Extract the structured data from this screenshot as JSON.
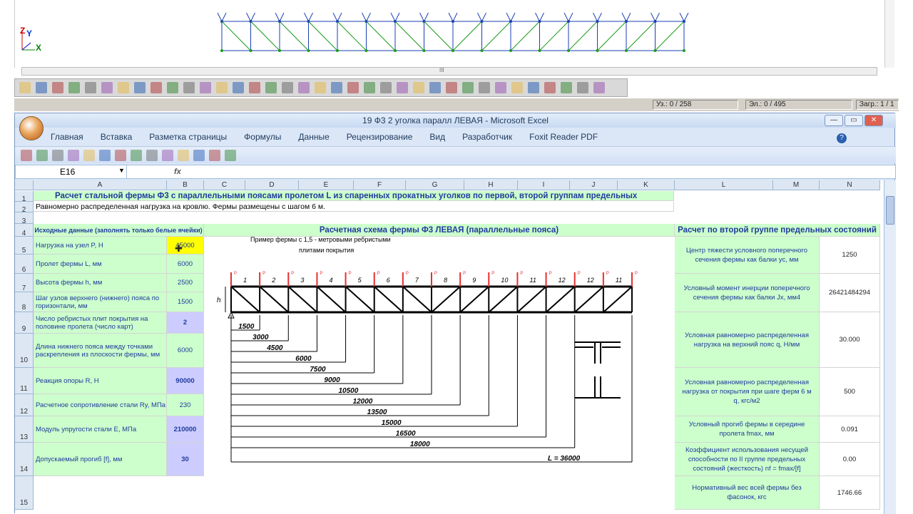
{
  "cad": {
    "axis_z": "Z",
    "axis_y": "Y",
    "axis_x": "X",
    "scroll_grip": "III",
    "status": [
      "Уз.: 0 / 258",
      "Эл.: 0 / 495",
      "Загр.: 1 / 1"
    ]
  },
  "excel": {
    "title": "19 Ф3 2 уголка паралл ЛЕВАЯ - Microsoft Excel",
    "tabs": [
      "Главная",
      "Вставка",
      "Разметка страницы",
      "Формулы",
      "Данные",
      "Рецензирование",
      "Вид",
      "Разработчик",
      "Foxit Reader PDF"
    ],
    "name_box": "E16",
    "fx": "fx",
    "columns": [
      "A",
      "B",
      "C",
      "D",
      "E",
      "F",
      "G",
      "H",
      "I",
      "J",
      "K",
      "L",
      "M",
      "N"
    ],
    "row1": "Расчет стальной фермы Ф3 с параллельными поясами пролетом L из спаренных прокатных уголков по первой, второй группам предельных",
    "row2": "Равномерно распределенная нагрузка на кровлю. Фермы размещены с шагом 6 м.",
    "row4_a": "Исходные данные (заполнять только белые ячейки)",
    "row4_scheme": "Расчетная схема фермы Ф3 ЛЕВАЯ (параллельные пояса)",
    "row4_right": "Расчет по второй группе предельных состояний",
    "scheme_note_1": "Пример фермы с 1,5 - метровыми ребристыми",
    "scheme_note_2": "плитами покрытия",
    "inputs": [
      {
        "row": "5",
        "label": "Нагрузка на узел P, Н",
        "value": "45000"
      },
      {
        "row": "6",
        "label": "Пролет фермы L, мм",
        "value": "6000"
      },
      {
        "row": "7",
        "label": "Высота фермы h, мм",
        "value": "2500"
      },
      {
        "row": "8",
        "label": "Шаг узлов верхнего (нижнего) пояса по горизонтали, мм",
        "value": "1500"
      },
      {
        "row": "9",
        "label": "Число ребристых плит покрытия на половине пролета (число карт)",
        "value": "2"
      },
      {
        "row": "10",
        "label": "Длина нижнего пояса между точками раскрепления из плоскости фермы, мм",
        "value": "6000"
      },
      {
        "row": "11",
        "label": "Реакция опоры R, Н",
        "value": "90000"
      },
      {
        "row": "12",
        "label": "Расчетное сопротивление стали Ry, МПа",
        "value": "230"
      },
      {
        "row": "13",
        "label": "Модуль упругости стали E, МПа",
        "value": "210000"
      },
      {
        "row": "14",
        "label": "Допускаемый прогиб [f], мм",
        "value": "30"
      }
    ],
    "right_rows": [
      {
        "label": "Центр тяжести условного поперечного сечения фермы как балки yc, мм",
        "value": "1250"
      },
      {
        "label": "Условный момент инерции поперечного сечения фермы как балки Jx, мм4",
        "value": "26421484294"
      },
      {
        "label": "Условная равномерно распределенная нагрузка на верхний пояс q, Н/мм",
        "value": "30.000"
      },
      {
        "label": "Условная равномерно распределенная нагрузка от покрытия при шаге ферм 6 м q, кгс/м2",
        "value": "500"
      },
      {
        "label": "Условный прогиб фермы в середине пролета fmax, мм",
        "value": "0.091"
      },
      {
        "label": "Коэффициент использования несущей способности по II группе предельных состояний (жесткость) nf = fmax/[f]",
        "value": "0.00"
      },
      {
        "label": "Нормативный вес всей фермы без фасонок, кгс",
        "value": "1746.66"
      }
    ],
    "panel_numbers": [
      "1",
      "2",
      "3",
      "4",
      "5",
      "6",
      "7",
      "8",
      "9",
      "10",
      "11",
      "12",
      "12",
      "11"
    ],
    "dims": [
      "1500",
      "3000",
      "4500",
      "6000",
      "7500",
      "9000",
      "10500",
      "12000",
      "13500",
      "15000",
      "16500",
      "18000"
    ],
    "span_label": "L = 36000",
    "h_label": "h",
    "rows_extra": [
      "1",
      "2",
      "3",
      "4",
      "15"
    ]
  }
}
